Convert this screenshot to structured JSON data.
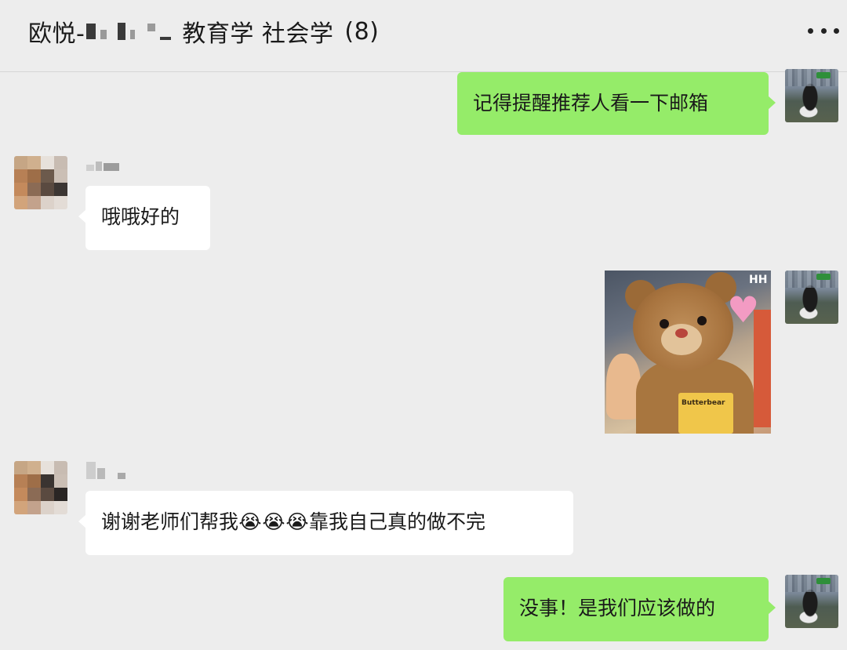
{
  "header": {
    "title_prefix": "欧悦-",
    "title_suffix": "教育学 社会学",
    "member_count": "(8)",
    "more_icon": "more-horizontal-icon"
  },
  "messages": [
    {
      "side": "self",
      "type": "text",
      "text": "记得提醒推荐人看一下邮箱"
    },
    {
      "side": "other",
      "type": "text",
      "text": "哦哦好的"
    },
    {
      "side": "self",
      "type": "image",
      "label": "Butterbear",
      "watermark": "HH"
    },
    {
      "side": "other",
      "type": "text",
      "parts": [
        "谢谢老师们帮我",
        "😭",
        "😭",
        "😭",
        "靠我自己真的做不完"
      ]
    },
    {
      "side": "self",
      "type": "text",
      "text": "没事！是我们应该做的"
    }
  ],
  "colors": {
    "background": "#ededed",
    "self_bubble": "#95ec69",
    "other_bubble": "#ffffff"
  }
}
